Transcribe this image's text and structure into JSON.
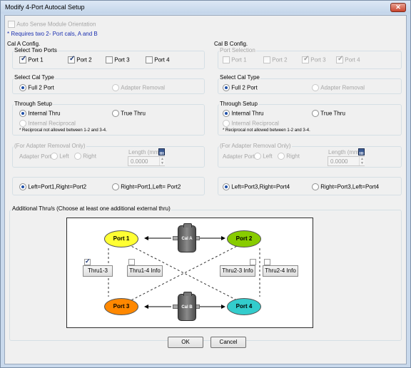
{
  "window": {
    "title": "Modify 4-Port Autocal Setup",
    "close_label": "✕"
  },
  "auto_sense": {
    "label": "Auto Sense Module Orientation",
    "checked": false,
    "enabled": false
  },
  "requires_note": "* Requires two 2- Port cals, A and B",
  "cal_a": {
    "title": "Cal A Config.",
    "select_ports": {
      "title": "Select Two Ports",
      "ports": [
        {
          "label": "Port 1",
          "checked": true
        },
        {
          "label": "Port 2",
          "checked": true
        },
        {
          "label": "Port 3",
          "checked": false
        },
        {
          "label": "Port 4",
          "checked": false
        }
      ]
    },
    "cal_type": {
      "title": "Select Cal Type",
      "options": [
        "Full 2 Port",
        "Adapter Removal"
      ],
      "selected": "Full 2 Port"
    },
    "through": {
      "title": "Through Setup",
      "options": [
        "Internal Thru",
        "True Thru",
        "Internal Reciprocal"
      ],
      "selected": "Internal Thru",
      "note": "* Reciprocal not allowed between 1-2 and 3-4."
    },
    "adapter": {
      "title": "(For Adapter Removal Only)",
      "port_label": "Adapter Port:",
      "left": "Left",
      "right": "Right",
      "length_label": "Length (mm)",
      "length_value": "0.0000"
    },
    "mapping": {
      "options": [
        "Left=Port1,Right=Port2",
        "Right=Port1,Left= Port2"
      ],
      "selected": "Left=Port1,Right=Port2"
    }
  },
  "cal_b": {
    "title": "Cal B Config.",
    "select_ports": {
      "title": "Port Selection",
      "ports": [
        {
          "label": "Port 1",
          "checked": false
        },
        {
          "label": "Port 2",
          "checked": false
        },
        {
          "label": "Port 3",
          "checked": true
        },
        {
          "label": "Port 4",
          "checked": true
        }
      ]
    },
    "cal_type": {
      "title": "Select Cal Type",
      "options": [
        "Full 2 Port",
        "Adapter Removal"
      ],
      "selected": "Full 2 Port"
    },
    "through": {
      "title": "Through Setup",
      "options": [
        "Internal Thru",
        "True Thru",
        "Internal Reciprocal"
      ],
      "selected": "Internal Thru",
      "note": "* Reciprocal not allowed between 1-2 and 3-4."
    },
    "adapter": {
      "title": "(For Adapter Removal Only)",
      "port_label": "Adapter Port:",
      "left": "Left",
      "right": "Right",
      "length_label": "Length (mm)",
      "length_value": "0.0000"
    },
    "mapping": {
      "options": [
        "Left=Port3,Right=Port4",
        "Right=Port3,Left=Port4"
      ],
      "selected": "Left=Port3,Right=Port4"
    }
  },
  "additional": {
    "title": "Additional Thru/s (Choose at least one additional external thru)",
    "ports": {
      "p1": "Port 1",
      "p2": "Port 2",
      "p3": "Port 3",
      "p4": "Port 4"
    },
    "cals": {
      "a": "Cal A",
      "b": "Cal B"
    },
    "thrus": [
      {
        "label": "Thru1-3",
        "checked": true
      },
      {
        "label": "Thru1-4 Info",
        "checked": false
      },
      {
        "label": "Thru2-3 Info",
        "checked": false
      },
      {
        "label": "Thru2-4 Info",
        "checked": false
      }
    ],
    "colors": {
      "port1": "#ffff33",
      "port2": "#88cc00",
      "port3": "#ff8800",
      "port4": "#33cccc"
    }
  },
  "buttons": {
    "ok": "OK",
    "cancel": "Cancel"
  }
}
